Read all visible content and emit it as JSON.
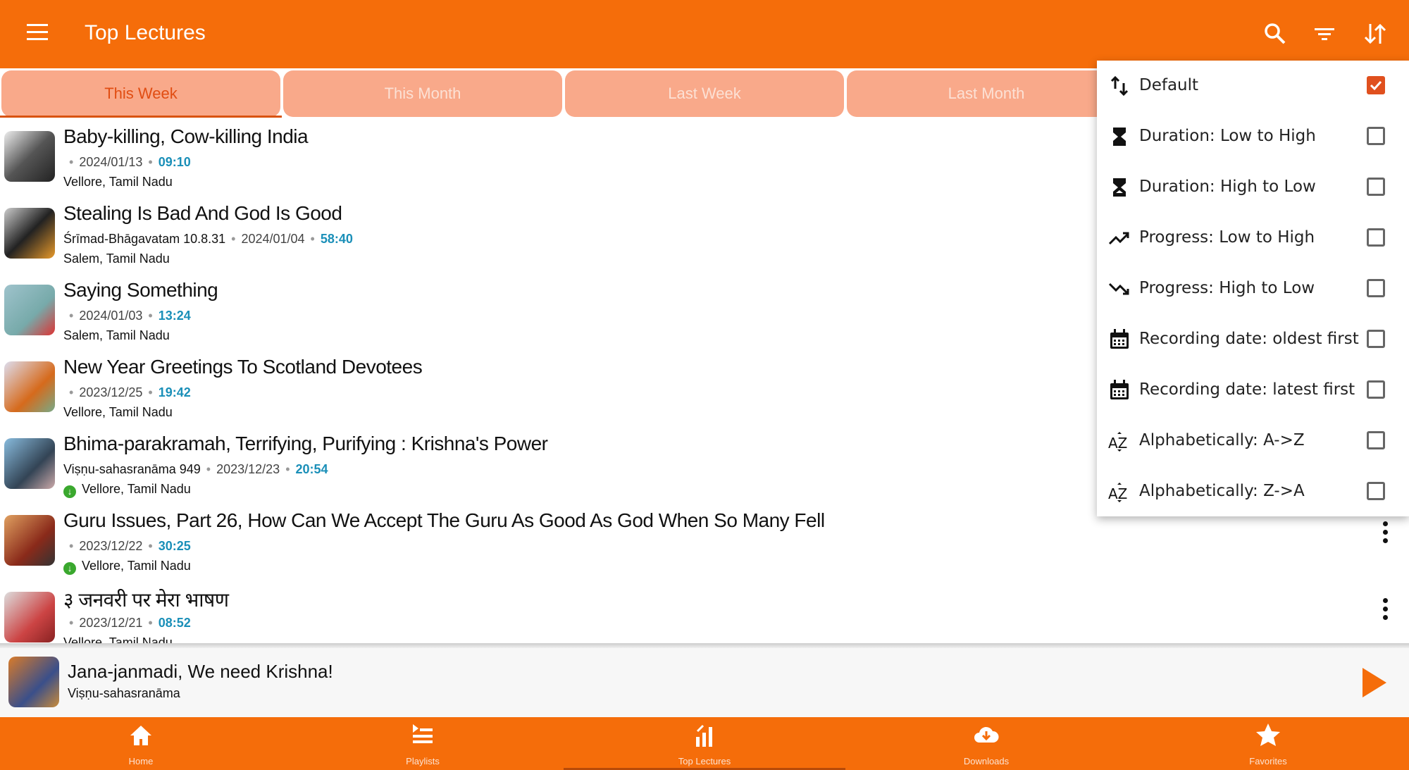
{
  "header": {
    "title": "Top Lectures",
    "icons": [
      "menu-icon",
      "search-icon",
      "filter-icon",
      "sort-icon"
    ]
  },
  "tabs": [
    {
      "label": "This Week",
      "active": true
    },
    {
      "label": "This Month"
    },
    {
      "label": "Last Week"
    },
    {
      "label": "Last Month"
    }
  ],
  "lectures": [
    {
      "title": "Baby-killing, Cow-killing India",
      "source": "",
      "date": "2024/01/13",
      "duration": "09:10",
      "location": "Vellore, Tamil Nadu",
      "downloaded": false
    },
    {
      "title": "Stealing Is Bad And God Is Good",
      "source": "Śrīmad-Bhāgavatam 10.8.31",
      "date": "2024/01/04",
      "duration": "58:40",
      "location": "Salem, Tamil Nadu",
      "downloaded": false
    },
    {
      "title": "Saying Something",
      "source": "",
      "date": "2024/01/03",
      "duration": "13:24",
      "location": "Salem, Tamil Nadu",
      "downloaded": false
    },
    {
      "title": "New Year Greetings To Scotland Devotees",
      "source": "",
      "date": "2023/12/25",
      "duration": "19:42",
      "location": "Vellore, Tamil Nadu",
      "downloaded": false
    },
    {
      "title": "Bhima-parakramah, Terrifying, Purifying : Krishna's Power",
      "source": "Viṣṇu-sahasranāma 949",
      "date": "2023/12/23",
      "duration": "20:54",
      "location": "Vellore, Tamil Nadu",
      "downloaded": true
    },
    {
      "title": "Guru Issues, Part 26, How Can We Accept The Guru As Good As God When So Many Fell",
      "source": "",
      "date": "2023/12/22",
      "duration": "30:25",
      "location": "Vellore, Tamil Nadu",
      "downloaded": true
    },
    {
      "title": "३ जनवरी पर मेरा भाषण",
      "source": "",
      "date": "2023/12/21",
      "duration": "08:52",
      "location": "Vellore, Tamil Nadu",
      "downloaded": false
    }
  ],
  "sort_menu": [
    {
      "label": "Default",
      "icon": "swap-vertical-icon",
      "checked": true
    },
    {
      "label": "Duration: Low to High",
      "icon": "hourglass-top-icon",
      "checked": false
    },
    {
      "label": "Duration: High to Low",
      "icon": "hourglass-bottom-icon",
      "checked": false
    },
    {
      "label": "Progress: Low to High",
      "icon": "trending-up-icon",
      "checked": false
    },
    {
      "label": "Progress: High to Low",
      "icon": "trending-down-icon",
      "checked": false
    },
    {
      "label": "Recording date: oldest first",
      "icon": "calendar-icon",
      "checked": false
    },
    {
      "label": "Recording date: latest first",
      "icon": "calendar-icon",
      "checked": false
    },
    {
      "label": "Alphabetically: A->Z",
      "icon": "sort-alpha-icon",
      "checked": false
    },
    {
      "label": "Alphabetically: Z->A",
      "icon": "sort-alpha-icon",
      "checked": false
    }
  ],
  "player": {
    "title": "Jana-janmadi, We need Krishna!",
    "subtitle": "Viṣṇu-sahasranāma"
  },
  "bottom_nav": [
    {
      "label": "Home",
      "icon": "home-icon"
    },
    {
      "label": "Playlists",
      "icon": "playlist-icon"
    },
    {
      "label": "Top Lectures",
      "icon": "chart-icon",
      "active": true
    },
    {
      "label": "Downloads",
      "icon": "cloud-download-icon"
    },
    {
      "label": "Favorites",
      "icon": "star-icon"
    }
  ],
  "colors": {
    "primary": "#f56d0a",
    "tab_bg": "#f9a98a",
    "duration": "#1a8fb8",
    "checked": "#e0501e",
    "download": "#3aa82e"
  }
}
